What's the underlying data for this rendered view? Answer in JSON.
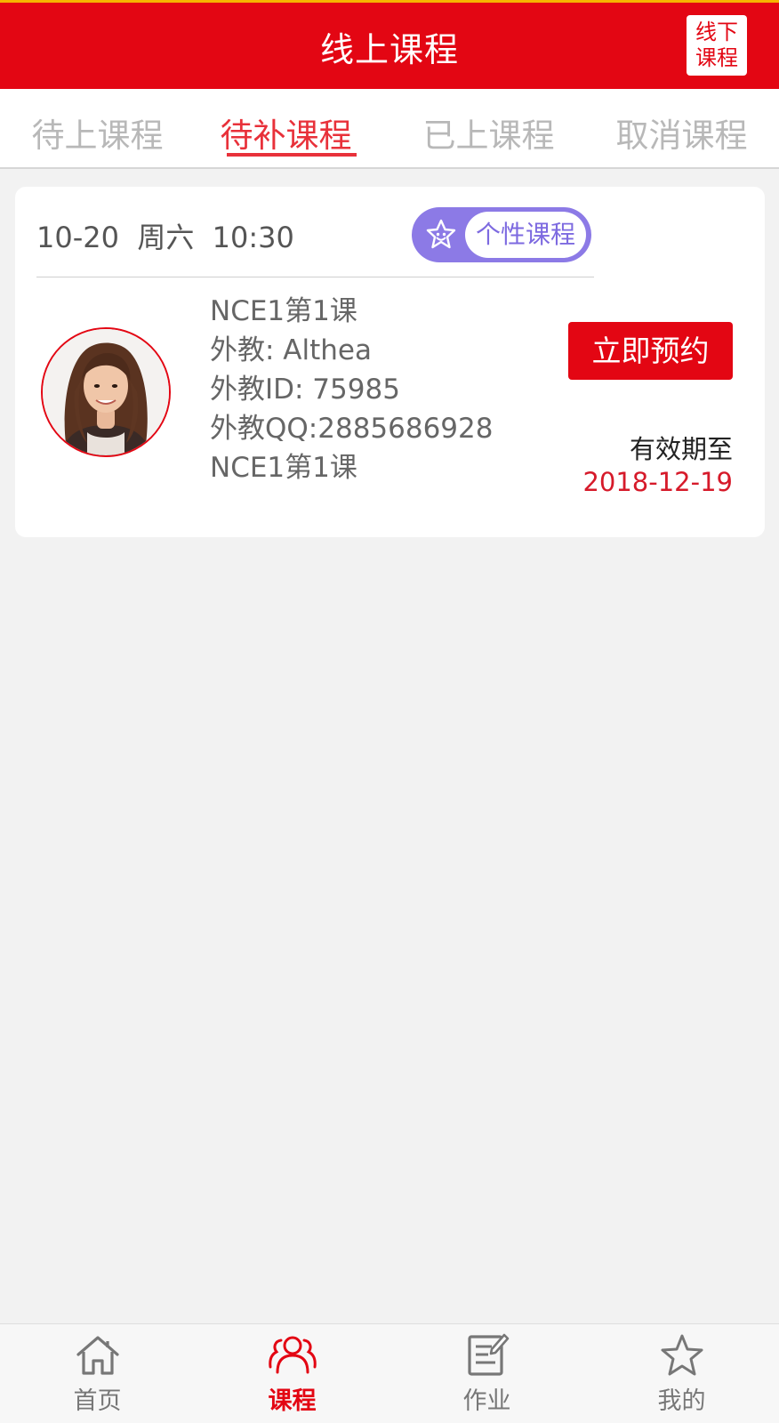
{
  "header": {
    "title": "线上课程",
    "offline_line1": "线下",
    "offline_line2": "课程"
  },
  "tabs": [
    {
      "label": "待上课程",
      "active": false
    },
    {
      "label": "待补课程",
      "active": true
    },
    {
      "label": "已上课程",
      "active": false
    },
    {
      "label": "取消课程",
      "active": false
    }
  ],
  "card": {
    "datetime": "10-20  周六  10:30",
    "badge": "个性课程",
    "info": [
      "NCE1第1课",
      "外教: Althea",
      "外教ID: 75985",
      "外教QQ:2885686928",
      "NCE1第1课"
    ],
    "book_label": "立即预约",
    "valid_label": "有效期至",
    "valid_date": "2018-12-19"
  },
  "bottom_nav": [
    {
      "label": "首页",
      "icon": "home-icon",
      "active": false
    },
    {
      "label": "课程",
      "icon": "people-icon",
      "active": true
    },
    {
      "label": "作业",
      "icon": "homework-icon",
      "active": false
    },
    {
      "label": "我的",
      "icon": "star-icon",
      "active": false
    }
  ],
  "colors": {
    "brand_red": "#e30613",
    "badge_purple": "#8c7ae6",
    "tab_active": "#e8313a"
  }
}
